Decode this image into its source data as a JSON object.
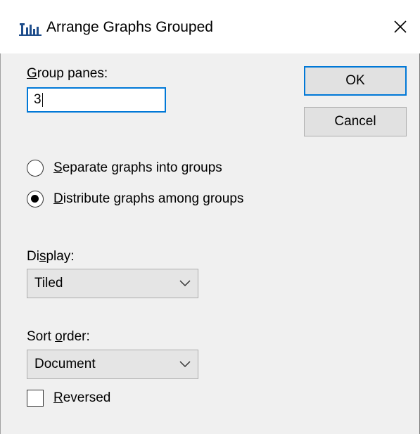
{
  "window": {
    "title": "Arrange Graphs Grouped",
    "icon": "graph-app-icon",
    "close_icon": "close-icon"
  },
  "group_panes": {
    "label_accel": "G",
    "label_rest": "roup panes:",
    "value": "3"
  },
  "buttons": {
    "ok": "OK",
    "cancel": "Cancel"
  },
  "radio_options": [
    {
      "accel": "S",
      "rest": "eparate graphs into groups",
      "selected": false
    },
    {
      "accel": "D",
      "rest": "istribute graphs among groups",
      "selected": true
    }
  ],
  "display": {
    "label_pre": "Di",
    "label_accel": "s",
    "label_post": "play:",
    "value": "Tiled"
  },
  "sort_order": {
    "label_pre": "Sort ",
    "label_accel": "o",
    "label_post": "rder:",
    "value": "Document"
  },
  "reversed": {
    "accel": "R",
    "rest": "eversed",
    "checked": false
  },
  "colors": {
    "focus": "#0078d7",
    "button_face": "#e1e1e1",
    "dialog_bg": "#f0f0f0"
  }
}
